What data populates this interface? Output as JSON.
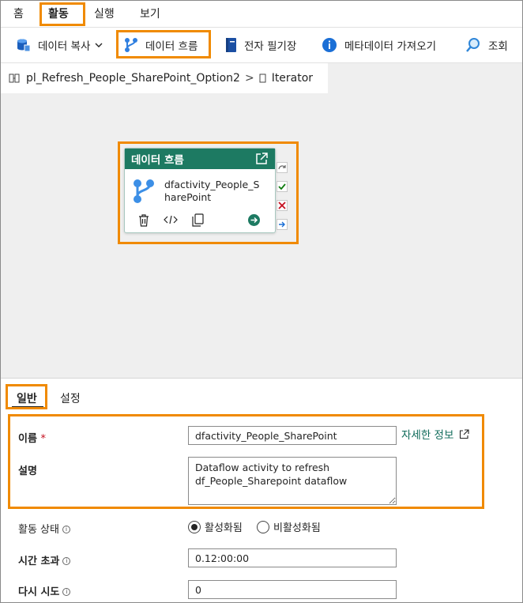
{
  "menu": {
    "items": [
      "홈",
      "활동",
      "실행",
      "보기"
    ]
  },
  "toolbar": {
    "copy_data": "데이터 복사",
    "dataflow": "데이터 흐름",
    "notebook": "전자 필기장",
    "get_metadata": "메타데이터 가져오기",
    "lookup": "조회"
  },
  "breadcrumb": {
    "pipeline": "pl_Refresh_People_SharePoint_Option2",
    "separator": ">",
    "current": "Iterator"
  },
  "card": {
    "title": "데이터 흐름",
    "activity_name": "dfactivity_People_SharePoint"
  },
  "panel": {
    "tabs": [
      "일반",
      "설정"
    ],
    "name_label": "이름",
    "required_mark": "*",
    "name_value": "dfactivity_People_SharePoint",
    "learn_more": "자세한 정보",
    "description_label": "설명",
    "description_value": "Dataflow activity to refresh\ndf_People_Sharepoint dataflow",
    "state_label": "활동 상태",
    "state_options": [
      "활성화됨",
      "비활성화됨"
    ],
    "state_selected": "활성화됨",
    "timeout_label": "시간 초과",
    "timeout_value": "0.12:00:00",
    "retry_label": "다시 시도",
    "retry_value": "0",
    "info_glyph": "i"
  },
  "colors": {
    "highlight": "#f08a00",
    "card_header": "#1d7a62",
    "link": "#0f6b5a"
  }
}
